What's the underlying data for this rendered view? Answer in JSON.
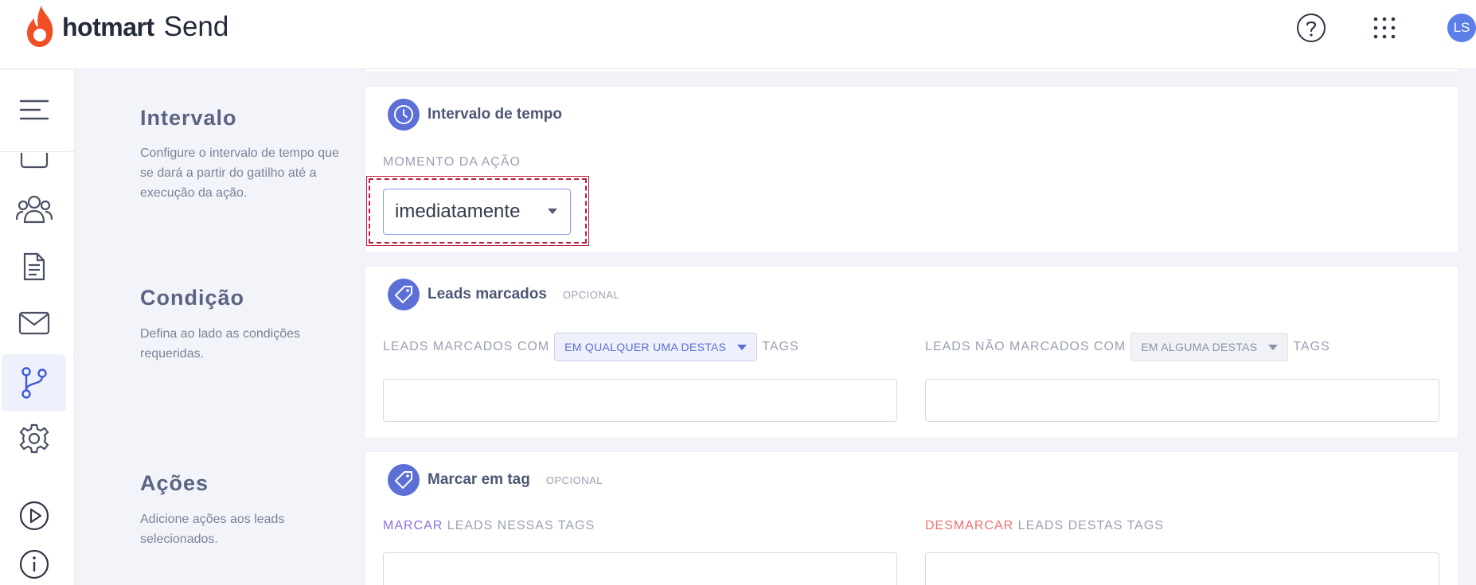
{
  "app": {
    "brand": "hotmart",
    "product": "Send"
  },
  "topbar": {
    "help_icon": "help-circle-icon",
    "apps_icon": "grid-dots-icon",
    "avatar_initials": "LS"
  },
  "sidebar": {
    "items": [
      {
        "icon": "menu-icon"
      },
      {
        "icon": "folder-icon"
      },
      {
        "icon": "users-icon"
      },
      {
        "icon": "document-icon"
      },
      {
        "icon": "mail-icon"
      },
      {
        "icon": "automation-icon",
        "active": true
      },
      {
        "icon": "gear-icon"
      },
      {
        "icon": "play-icon"
      },
      {
        "icon": "info-icon"
      }
    ]
  },
  "sections": {
    "interval": {
      "title": "Intervalo",
      "desc": "Configure o intervalo de tempo que se dará a partir do gatilho até a execução da ação.",
      "card_title": "Intervalo de tempo",
      "field_label": "MOMENTO DA AÇÃO",
      "select_value": "imediatamente"
    },
    "condition": {
      "title": "Condição",
      "desc": "Defina ao lado as condições requeridas.",
      "card_title": "Leads marcados",
      "optional": "OPCIONAL",
      "left_label": "LEADS MARCADOS COM",
      "left_select": "EM QUALQUER UMA DESTAS",
      "left_suffix": "TAGS",
      "right_label": "LEADS NÃO MARCADOS COM",
      "right_select": "EM ALGUMA DESTAS",
      "right_suffix": "TAGS"
    },
    "actions": {
      "title": "Ações",
      "desc": "Adicione ações aos leads selecionados.",
      "card_title": "Marcar em tag",
      "optional": "OPCIONAL",
      "left_highlight": "MARCAR",
      "left_label": " LEADS NESSAS TAGS",
      "right_highlight": "DESMARCAR",
      "right_label": " LEADS DESTAS TAGS"
    }
  },
  "colors": {
    "accent": "#5b6fd6",
    "marcar": "#8b6fe0",
    "desmarcar": "#ef6f6f",
    "brand_flame": "#f04e23"
  }
}
